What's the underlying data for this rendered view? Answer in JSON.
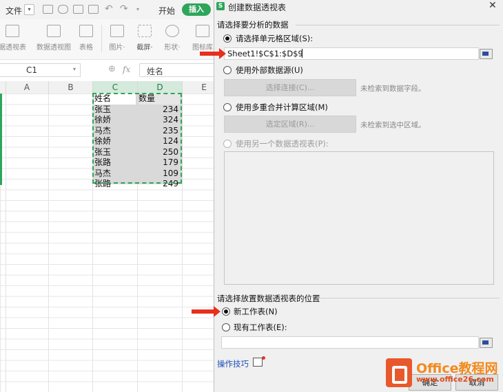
{
  "spreadsheet": {
    "menu": {
      "file_label": "文件",
      "start_tab": "开始",
      "insert_tab": "插入"
    },
    "ribbon": [
      {
        "label": "据透视表",
        "icon": "pivot-table-icon"
      },
      {
        "label": "数据透视图",
        "icon": "pivot-chart-icon"
      },
      {
        "label": "表格",
        "icon": "table-icon"
      },
      {
        "label": "图片·",
        "icon": "picture-icon"
      },
      {
        "label": "截屏·",
        "icon": "screenshot-icon"
      },
      {
        "label": "形状·",
        "icon": "shape-icon"
      },
      {
        "label": "图标库",
        "icon": "icon-library-icon"
      }
    ],
    "name_box": "C1",
    "fx_symbol": "fx",
    "formula_value": "姓名",
    "columns": [
      "A",
      "B",
      "C",
      "D",
      "E"
    ],
    "selected_columns": [
      "C",
      "D"
    ],
    "headers": [
      "姓名",
      "数量"
    ],
    "rows": [
      {
        "name": "张玉",
        "qty": "234"
      },
      {
        "name": "徐娇",
        "qty": "324"
      },
      {
        "name": "马杰",
        "qty": "235"
      },
      {
        "name": "徐娇",
        "qty": "124"
      },
      {
        "name": "张玉",
        "qty": "250"
      },
      {
        "name": "张路",
        "qty": "179"
      },
      {
        "name": "马杰",
        "qty": "109"
      },
      {
        "name": "张路",
        "qty": "249"
      }
    ]
  },
  "dialog": {
    "title": "创建数据透视表",
    "close": "✕",
    "section1": "请选择要分析的数据",
    "opt_range_label": "请选择单元格区域(S):",
    "range_value": "Sheet1!$C$1:$D$9",
    "opt_external_label": "使用外部数据源(U)",
    "choose_connection_button": "选择连接(C)...",
    "no_fields_note": "未检索到数据字段。",
    "opt_multi_label": "使用多重合并计算区域(M)",
    "select_region_button": "选定区域(R)...",
    "no_region_note": "未检索到选中区域。",
    "opt_other_pivot_label": "使用另一个数据透视表(P):",
    "section2": "请选择放置数据透视表的位置",
    "opt_new_sheet_label": "新工作表(N)",
    "opt_existing_label": "现有工作表(E):",
    "tips_label": "操作技巧",
    "ok_button": "确定",
    "cancel_button": "取消"
  },
  "watermark": {
    "title": "Office教程网",
    "url": "www.office26.com"
  },
  "colors": {
    "accent_green": "#2fa55b",
    "arrow_red": "#e82e1d",
    "link_blue": "#1c4fb8"
  }
}
